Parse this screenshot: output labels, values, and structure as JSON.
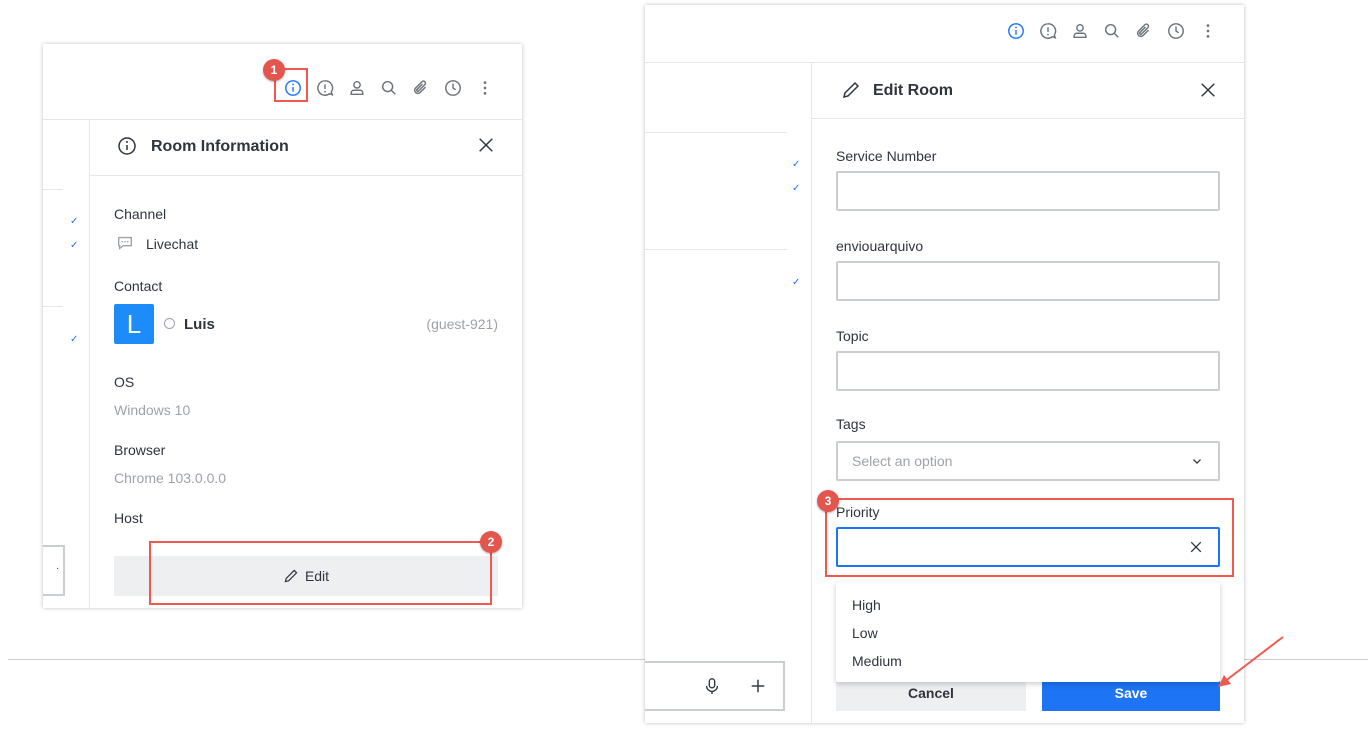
{
  "left": {
    "panel_title": "Room Information",
    "channel": {
      "label": "Channel",
      "value": "Livechat"
    },
    "contact": {
      "label": "Contact",
      "avatar_letter": "L",
      "name": "Luis",
      "username": "(guest-921)"
    },
    "os": {
      "label": "OS",
      "value": "Windows 10"
    },
    "browser": {
      "label": "Browser",
      "value": "Chrome 103.0.0.0"
    },
    "host": {
      "label": "Host"
    },
    "edit_label": "Edit",
    "composer_text": "."
  },
  "right": {
    "panel_title": "Edit Room",
    "fields": {
      "service_number": {
        "label": "Service Number",
        "value": ""
      },
      "enviouarquivo": {
        "label": "enviouarquivo",
        "value": ""
      },
      "topic": {
        "label": "Topic",
        "value": ""
      },
      "tags": {
        "label": "Tags",
        "placeholder": "Select an option"
      },
      "priority": {
        "label": "Priority",
        "value": ""
      }
    },
    "priority_options": [
      "High",
      "Low",
      "Medium"
    ],
    "cancel_label": "Cancel",
    "save_label": "Save"
  },
  "annotations": {
    "badge_1": "1",
    "badge_2": "2",
    "badge_3": "3"
  },
  "colors": {
    "accent": "#1d74f5",
    "annotation": "#f0594f",
    "avatar": "#1d8cf8"
  },
  "icons": [
    "info-icon",
    "discussion-icon",
    "user-icon",
    "search-icon",
    "attachment-icon",
    "clock-icon",
    "kebab-icon",
    "close-icon",
    "pencil-icon",
    "chat-bubble-icon",
    "chevron-down-icon",
    "microphone-icon",
    "plus-icon",
    "check-icon"
  ]
}
